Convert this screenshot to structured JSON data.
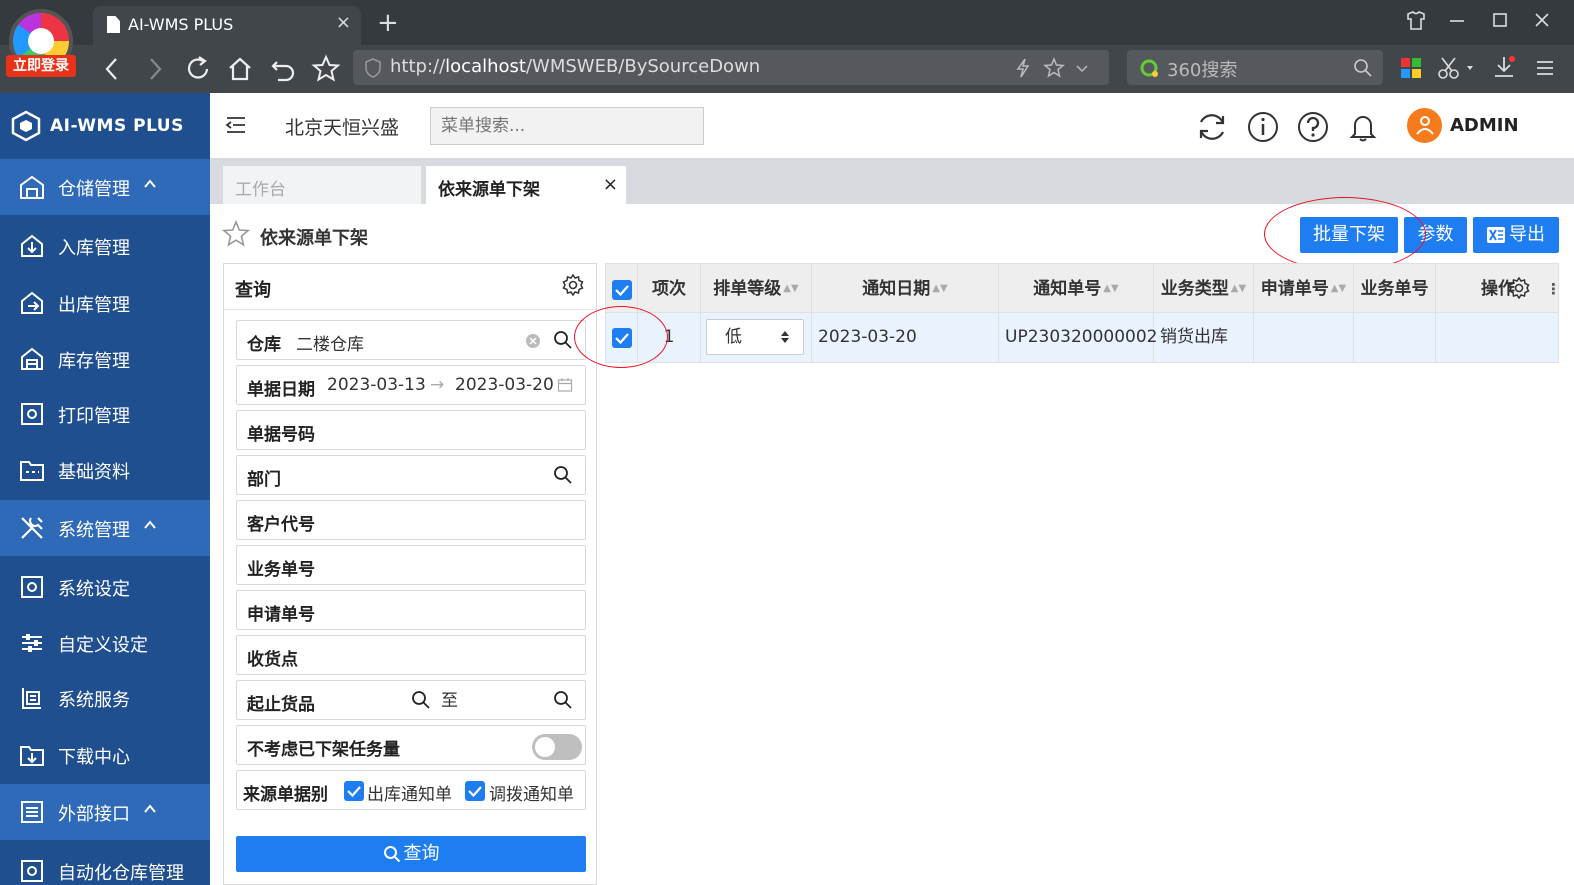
{
  "browser": {
    "login_badge": "立即登录",
    "tab_title": "AI-WMS PLUS",
    "tab_close": "×",
    "new_tab": "+",
    "url_prefix": "http://",
    "url_host": "localhost",
    "url_path": "/WMSWEB/BySourceDown",
    "search_engine": "360搜索"
  },
  "sidebar": {
    "logo_text": "AI-WMS PLUS",
    "items": [
      {
        "label": "仓储管理",
        "type": "group",
        "icon": "warehouse-icon"
      },
      {
        "label": "入库管理",
        "type": "item",
        "icon": "inbound-icon"
      },
      {
        "label": "出库管理",
        "type": "item",
        "icon": "outbound-icon"
      },
      {
        "label": "库存管理",
        "type": "item",
        "icon": "inventory-icon"
      },
      {
        "label": "打印管理",
        "type": "item",
        "icon": "print-icon"
      },
      {
        "label": "基础资料",
        "type": "item",
        "icon": "folder-icon"
      },
      {
        "label": "系统管理",
        "type": "group",
        "icon": "tools-icon"
      },
      {
        "label": "系统设定",
        "type": "item",
        "icon": "settings-icon"
      },
      {
        "label": "自定义设定",
        "type": "item",
        "icon": "sliders-icon"
      },
      {
        "label": "系统服务",
        "type": "item",
        "icon": "service-icon"
      },
      {
        "label": "下载中心",
        "type": "item",
        "icon": "download-icon"
      },
      {
        "label": "外部接口",
        "type": "group",
        "icon": "interface-icon"
      },
      {
        "label": "自动化仓库管理",
        "type": "item",
        "icon": "automation-icon"
      }
    ]
  },
  "header": {
    "company": "北京天恒兴盛",
    "menu_search_placeholder": "菜单搜索...",
    "user": "ADMIN"
  },
  "tabs": [
    {
      "label": "工作台",
      "active": false
    },
    {
      "label": "依来源单下架",
      "active": true,
      "close": "×"
    }
  ],
  "page": {
    "title": "依来源单下架",
    "buttons": {
      "batch_down": "批量下架",
      "params": "参数",
      "export": "导出"
    }
  },
  "query": {
    "title": "查询",
    "warehouse_label": "仓库",
    "warehouse_value": "二楼仓库",
    "date_label": "单据日期",
    "date_from": "2023-03-13",
    "date_arrow": "→",
    "date_to": "2023-03-20",
    "doc_no_label": "单据号码",
    "dept_label": "部门",
    "customer_label": "客户代号",
    "biz_no_label": "业务单号",
    "apply_no_label": "申请单号",
    "receive_label": "收货点",
    "goods_label": "起止货品",
    "goods_to": "至",
    "ignore_label": "不考虑已下架任务量",
    "source_label": "来源单据别",
    "source_opt1": "出库通知单",
    "source_opt2": "调拨通知单",
    "submit": "查询"
  },
  "grid": {
    "columns": [
      "项次",
      "排单等级",
      "通知日期",
      "通知单号",
      "业务类型",
      "申请单号",
      "业务单号",
      "操作"
    ],
    "rows": [
      {
        "index": "1",
        "level": "低",
        "date": "2023-03-20",
        "notice_no": "UP230320000002",
        "biz_type": "销货出库",
        "apply_no": "",
        "biz_no": "",
        "op": ""
      }
    ]
  },
  "colors": {
    "sidebar_bg": "#1f4f8f",
    "sidebar_group_bg": "#2f6ab8",
    "primary": "#1e7ef1",
    "highlight": "#e12222"
  }
}
